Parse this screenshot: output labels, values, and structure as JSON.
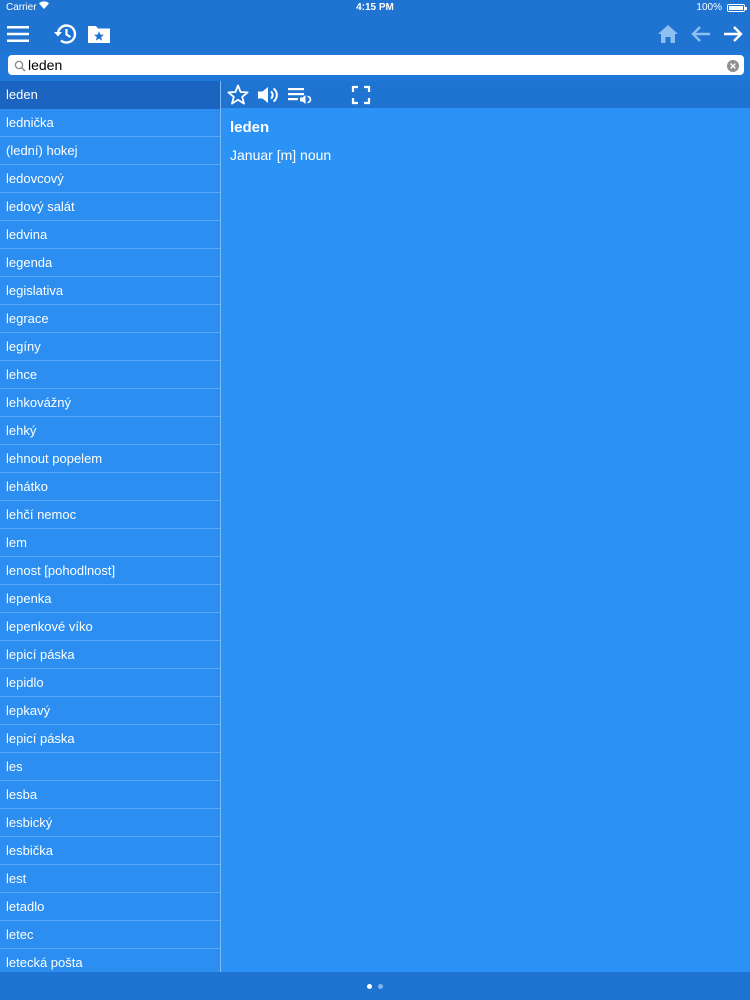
{
  "status": {
    "carrier": "Carrier",
    "time": "4:15 PM",
    "battery": "100%"
  },
  "toolbar": {
    "icons": [
      "menu-icon",
      "history-icon",
      "favorites-folder-icon",
      "home-icon",
      "back-arrow-icon",
      "forward-arrow-icon"
    ]
  },
  "search": {
    "value": "leden",
    "placeholder": ""
  },
  "wordlist": {
    "selected_index": 0,
    "items": [
      "leden",
      "lednička",
      "(lední) hokej",
      "ledovcový",
      "ledový salát",
      "ledvina",
      "legenda",
      "legislativa",
      "legrace",
      "legíny",
      "lehce",
      "lehkovážný",
      "lehký",
      "lehnout popelem",
      "lehátko",
      "lehčí nemoc",
      "lem",
      "lenost [pohodlnost]",
      "lepenka",
      "lepenkové víko",
      "lepicí páska",
      "lepidlo",
      "lepkavý",
      "lepicí páska",
      "les",
      "lesba",
      "lesbický",
      "lesbička",
      "lest",
      "letadlo",
      "letec",
      "letecká pošta"
    ]
  },
  "detail": {
    "toolbar_icons": [
      "star-icon",
      "speaker-icon",
      "playlist-audio-icon",
      "fullscreen-icon"
    ],
    "headword": "leden",
    "definition": "Januar [m] noun"
  },
  "pager": {
    "pages": 2,
    "current": 1
  },
  "colors": {
    "bar": "#1f74d2",
    "list_bg": "#2b8ef0",
    "detail_bg": "#2b93f5",
    "selected": "#1b64c0"
  }
}
